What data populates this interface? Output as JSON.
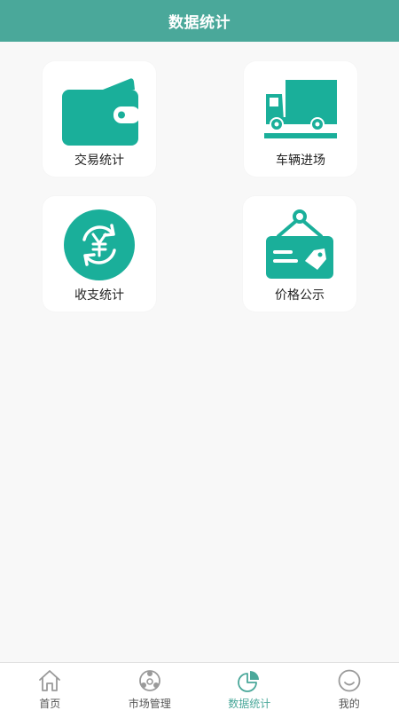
{
  "header": {
    "title": "数据统计"
  },
  "tiles": [
    {
      "label": "交易统计",
      "icon": "wallet-icon"
    },
    {
      "label": "车辆进场",
      "icon": "truck-icon"
    },
    {
      "label": "收支统计",
      "icon": "yen-exchange-icon"
    },
    {
      "label": "价格公示",
      "icon": "price-tag-sign-icon"
    }
  ],
  "tabbar": {
    "items": [
      {
        "label": "首页",
        "icon": "home-icon",
        "active": false
      },
      {
        "label": "市场管理",
        "icon": "market-icon",
        "active": false
      },
      {
        "label": "数据统计",
        "icon": "pie-chart-icon",
        "active": true
      },
      {
        "label": "我的",
        "icon": "smiley-icon",
        "active": false
      }
    ]
  },
  "colors": {
    "header": "#4aa89a",
    "icon": "#1aaf9a",
    "active_tab": "#4aa89a",
    "inactive_tab_icon": "#9a9a9a"
  }
}
